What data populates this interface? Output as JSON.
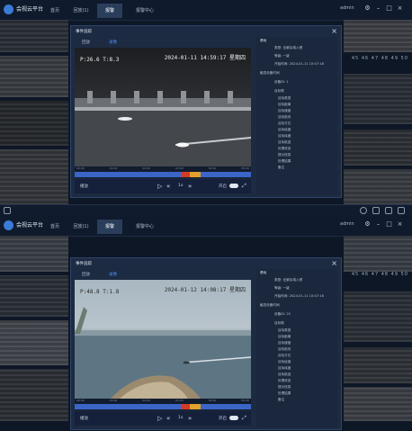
{
  "app": {
    "title": "会视云平台",
    "user": "admin",
    "tabs": [
      "首页",
      "回放(1)",
      "报警",
      "报警中心"
    ],
    "active_tab_index": 2
  },
  "grid_numbers": "45 46 47 48 49 50",
  "panel1": {
    "dialog_title": "事件追踪",
    "subtabs": [
      "回放",
      "录像"
    ],
    "osd_left": "P:26.6 T:8.3",
    "osd_right": "2024-01-11 14:59:17 星期四",
    "speed": "1x",
    "ctrl_left": "播放",
    "ctrl_mid": "开启",
    "info": {
      "header": "基础",
      "lines": [
        "类型: 全景区域入侵",
        "等级: 一级",
        "开始时间: 2024-01-11 15:07:16",
        "触发设备时间",
        "设备ID: 1",
        "目标物",
        "目标类型",
        "目标距离",
        "目标速度",
        "目标航向",
        "目标方位",
        "目标经度",
        "目标纬度",
        "目标航迹",
        "处理状态",
        "提示信息",
        "处理结果",
        "备注"
      ]
    }
  },
  "panel2": {
    "dialog_title": "事件追踪",
    "subtabs": [
      "回放",
      "录像"
    ],
    "osd_left": "P:48.8 T:1.8",
    "osd_right": "2024-01-12 14:08:17 星期四",
    "speed": "1x",
    "ctrl_left": "播放",
    "ctrl_mid": "开启",
    "info": {
      "header": "基础",
      "lines": [
        "类型: 全景区域入侵",
        "等级: 一级",
        "开始时间: 2024-01-11 15:07:16",
        "触发设备时间",
        "设备ID: 25",
        "目标物",
        "目标类型",
        "目标距离",
        "目标速度",
        "目标航向",
        "目标方位",
        "目标经度",
        "目标纬度",
        "目标航迹",
        "处理状态",
        "提示信息",
        "处理结果",
        "备注"
      ]
    }
  },
  "timeline_ticks": [
    "00:00",
    "00:30",
    "01:00",
    "01:30",
    "02:00",
    "02:30",
    "03:00",
    "03:30",
    "04:00",
    "04:30",
    "05:00"
  ]
}
